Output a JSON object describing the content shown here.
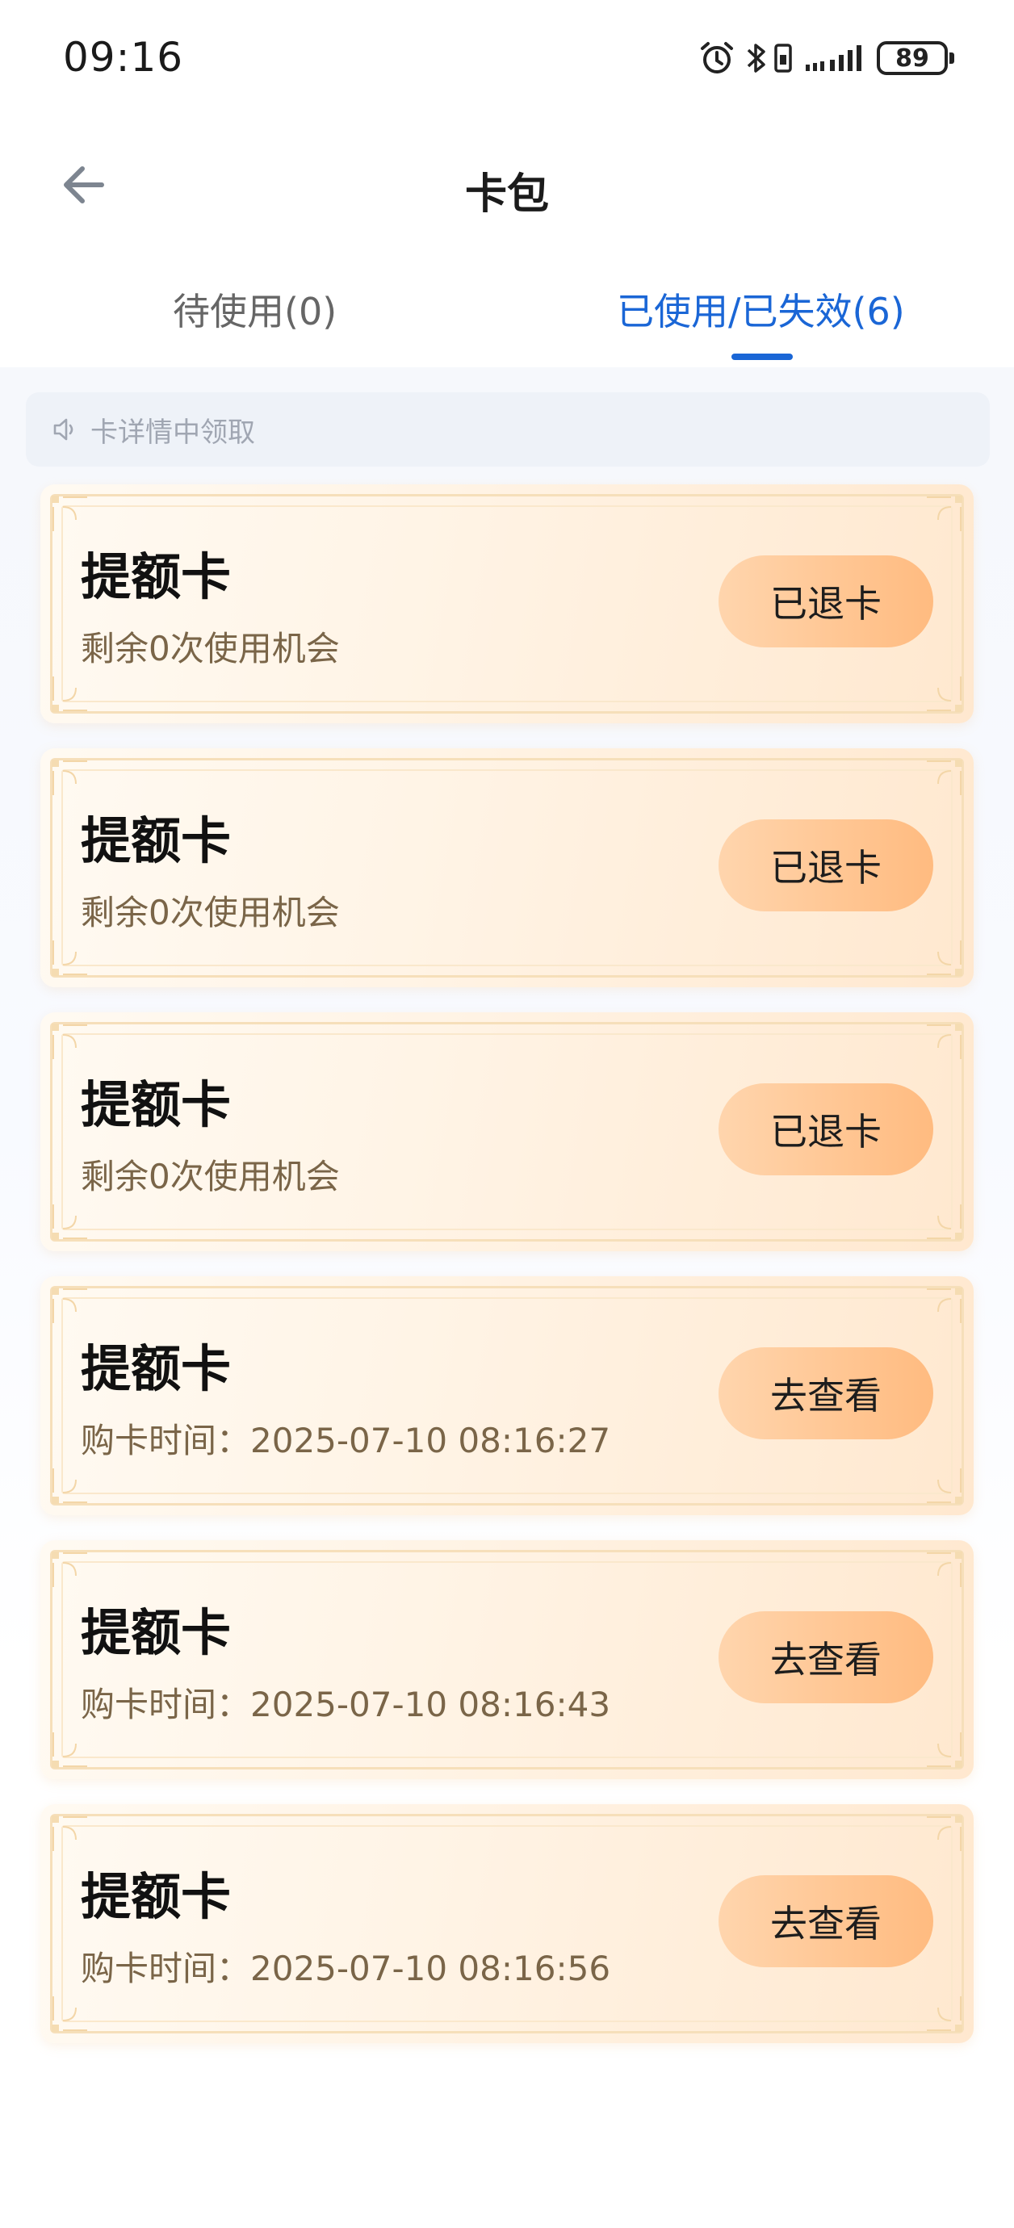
{
  "status_bar": {
    "time": "09:16",
    "battery": "89"
  },
  "header": {
    "title": "卡包"
  },
  "tabs": {
    "pending_label": "待使用(0)",
    "used_label": "已使用/已失效(6)",
    "active": "used"
  },
  "notice": {
    "text": "卡详情中领取"
  },
  "cards": [
    {
      "title": "提额卡",
      "subtitle": "剩余0次使用机会",
      "button": "已退卡"
    },
    {
      "title": "提额卡",
      "subtitle": "剩余0次使用机会",
      "button": "已退卡"
    },
    {
      "title": "提额卡",
      "subtitle": "剩余0次使用机会",
      "button": "已退卡"
    },
    {
      "title": "提额卡",
      "subtitle": "购卡时间：2025-07-10 08:16:27",
      "button": "去查看"
    },
    {
      "title": "提额卡",
      "subtitle": "购卡时间：2025-07-10 08:16:43",
      "button": "去查看"
    },
    {
      "title": "提额卡",
      "subtitle": "购卡时间：2025-07-10 08:16:56",
      "button": "去查看"
    }
  ],
  "colors": {
    "accent": "#1a66d6",
    "button_gradient_start": "#ffd5ad",
    "button_gradient_end": "#ffbb80",
    "subtitle": "#7a6548"
  }
}
